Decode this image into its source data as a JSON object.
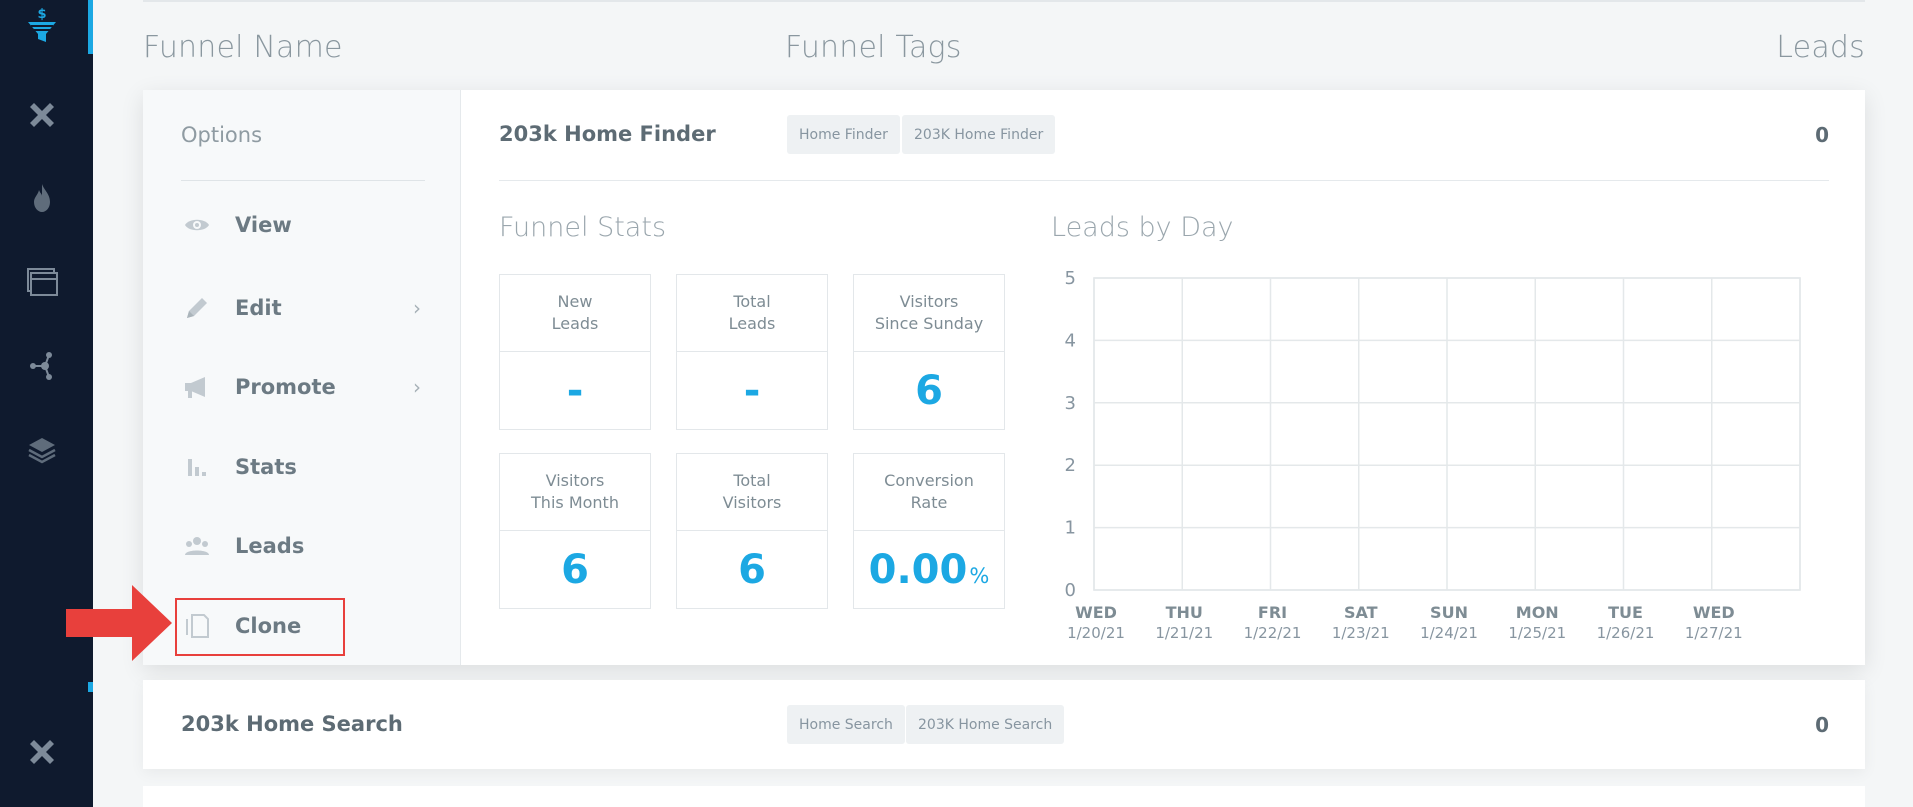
{
  "sidebar": {
    "icons": [
      "funnel-dollar-icon",
      "tools-icon",
      "flame-icon",
      "windows-icon",
      "network-icon",
      "layers-icon",
      "tools-bottom-icon"
    ]
  },
  "columns": {
    "name": "Funnel Name",
    "tags": "Funnel Tags",
    "leads": "Leads"
  },
  "options": {
    "title": "Options",
    "items": [
      {
        "label": "View",
        "icon": "eye-icon",
        "submenu": false
      },
      {
        "label": "Edit",
        "icon": "pencil-icon",
        "submenu": true
      },
      {
        "label": "Promote",
        "icon": "megaphone-icon",
        "submenu": true
      },
      {
        "label": "Stats",
        "icon": "bar-chart-icon",
        "submenu": false
      },
      {
        "label": "Leads",
        "icon": "people-icon",
        "submenu": false
      },
      {
        "label": "Clone",
        "icon": "copy-icon",
        "submenu": false
      }
    ]
  },
  "funnels": [
    {
      "name": "203k Home Finder",
      "tags": [
        "Home Finder",
        "203K Home Finder"
      ],
      "leads": "0"
    },
    {
      "name": "203k Home Search",
      "tags": [
        "Home Search",
        "203K Home Search"
      ],
      "leads": "0"
    }
  ],
  "stats": {
    "title": "Funnel Stats",
    "boxes": [
      {
        "line1": "New",
        "line2": "Leads",
        "value": "-",
        "suffix": ""
      },
      {
        "line1": "Total",
        "line2": "Leads",
        "value": "-",
        "suffix": ""
      },
      {
        "line1": "Visitors",
        "line2": "Since Sunday",
        "value": "6",
        "suffix": ""
      },
      {
        "line1": "Visitors",
        "line2": "This Month",
        "value": "6",
        "suffix": ""
      },
      {
        "line1": "Total",
        "line2": "Visitors",
        "value": "6",
        "suffix": ""
      },
      {
        "line1": "Conversion",
        "line2": "Rate",
        "value": "0.00",
        "suffix": "%"
      }
    ]
  },
  "chart_title": "Leads by Day",
  "chart_data": {
    "type": "bar",
    "title": "Leads by Day",
    "categories": [
      {
        "day": "WED",
        "date": "1/20/21"
      },
      {
        "day": "THU",
        "date": "1/21/21"
      },
      {
        "day": "FRI",
        "date": "1/22/21"
      },
      {
        "day": "SAT",
        "date": "1/23/21"
      },
      {
        "day": "SUN",
        "date": "1/24/21"
      },
      {
        "day": "MON",
        "date": "1/25/21"
      },
      {
        "day": "TUE",
        "date": "1/26/21"
      },
      {
        "day": "WED",
        "date": "1/27/21"
      }
    ],
    "values": [
      0,
      0,
      0,
      0,
      0,
      0,
      0,
      0
    ],
    "yticks": [
      "0",
      "1",
      "2",
      "3",
      "4",
      "5"
    ],
    "ylim": [
      0,
      5
    ],
    "grid": true
  },
  "colors": {
    "accent": "#1ca8e3",
    "sidebar": "#0f1a2e",
    "highlight": "#e8403c"
  }
}
